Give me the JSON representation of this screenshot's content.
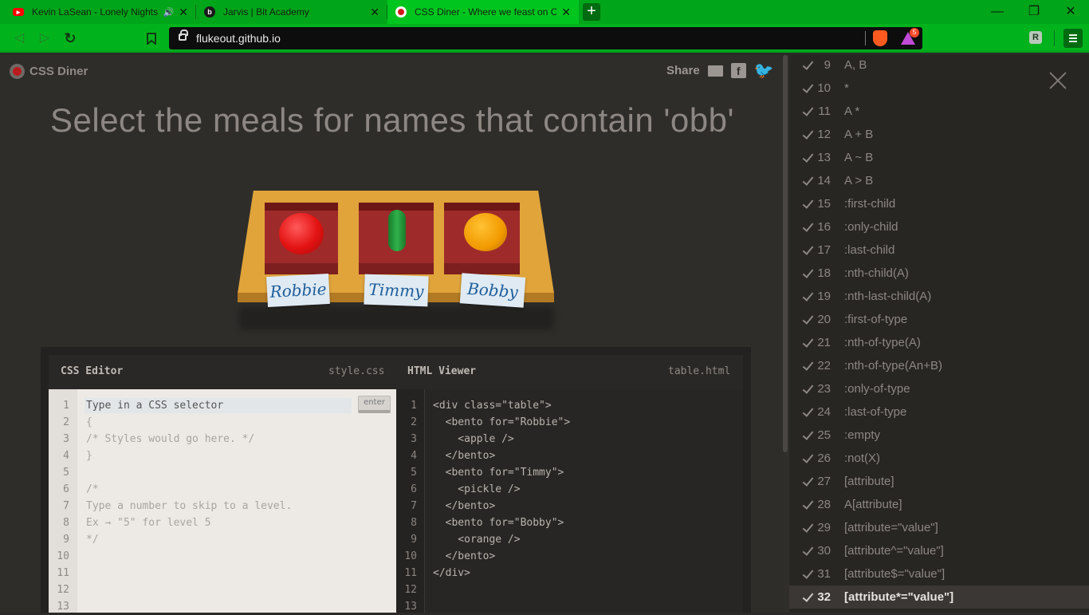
{
  "tabs": [
    {
      "title": "Kevin LaSean - Lonely Nights",
      "icon": "youtube-icon",
      "audio": "speaker-icon",
      "close": "✕"
    },
    {
      "title": "Jarvis | Bit Academy",
      "icon": "bit-academy-icon",
      "close": "✕"
    },
    {
      "title": "CSS Diner - Where we feast on CSS",
      "icon": "css-diner-icon",
      "close": "✕"
    }
  ],
  "new_tab": "+",
  "window": {
    "minimize": "—",
    "maximize": "❐",
    "close": "✕"
  },
  "toolbar": {
    "url": "flukeout.github.io",
    "rewards_badge": "5",
    "extension_label": "R"
  },
  "app": {
    "name": "CSS Diner"
  },
  "share": {
    "label": "Share"
  },
  "order": "Select the meals for names that contain 'obb'",
  "names": [
    "Robbie",
    "Timmy",
    "Bobby"
  ],
  "editor": {
    "css_title": "CSS Editor",
    "css_file": "style.css",
    "html_title": "HTML Viewer",
    "html_file": "table.html",
    "input_placeholder": "Type in a CSS selector",
    "enter_label": "enter",
    "css_lines": [
      "",
      "{",
      "/* Styles would go here. */",
      "}",
      "",
      "/*",
      "Type a number to skip to a level.",
      "Ex → \"5\" for level 5",
      "*/",
      "",
      "",
      "",
      ""
    ],
    "html_lines": [
      "<div class=\"table\">",
      "  <bento for=\"Robbie\">",
      "    <apple />",
      "  </bento>",
      "  <bento for=\"Timmy\">",
      "    <pickle />",
      "  </bento>",
      "  <bento for=\"Bobby\">",
      "    <orange />",
      "  </bento>",
      "</div>",
      "",
      ""
    ],
    "line_numbers": [
      "1",
      "2",
      "3",
      "4",
      "5",
      "6",
      "7",
      "8",
      "9",
      "10",
      "11",
      "12",
      "13"
    ]
  },
  "levels": [
    {
      "num": "9",
      "name": "A, B"
    },
    {
      "num": "10",
      "name": "*"
    },
    {
      "num": "11",
      "name": "A  *"
    },
    {
      "num": "12",
      "name": "A + B"
    },
    {
      "num": "13",
      "name": "A ~ B"
    },
    {
      "num": "14",
      "name": "A > B"
    },
    {
      "num": "15",
      "name": ":first-child"
    },
    {
      "num": "16",
      "name": ":only-child"
    },
    {
      "num": "17",
      "name": ":last-child"
    },
    {
      "num": "18",
      "name": ":nth-child(A)"
    },
    {
      "num": "19",
      "name": ":nth-last-child(A)"
    },
    {
      "num": "20",
      "name": ":first-of-type"
    },
    {
      "num": "21",
      "name": ":nth-of-type(A)"
    },
    {
      "num": "22",
      "name": ":nth-of-type(An+B)"
    },
    {
      "num": "23",
      "name": ":only-of-type"
    },
    {
      "num": "24",
      "name": ":last-of-type"
    },
    {
      "num": "25",
      "name": ":empty"
    },
    {
      "num": "26",
      "name": ":not(X)"
    },
    {
      "num": "27",
      "name": "[attribute]"
    },
    {
      "num": "28",
      "name": "A[attribute]"
    },
    {
      "num": "29",
      "name": "[attribute=\"value\"]"
    },
    {
      "num": "30",
      "name": "[attribute^=\"value\"]"
    },
    {
      "num": "31",
      "name": "[attribute$=\"value\"]"
    },
    {
      "num": "32",
      "name": "[attribute*=\"value\"]"
    }
  ],
  "current_level": "32",
  "colors": {
    "browser_accent": "#00a51a",
    "page_bg": "#2f2d2a",
    "table": "#e0a43a",
    "bento": "#9e2b2a"
  }
}
